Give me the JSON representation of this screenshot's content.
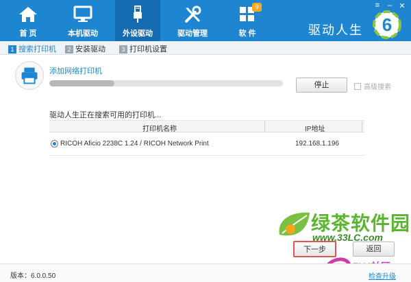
{
  "nav": {
    "items": [
      {
        "label": "首 页",
        "icon": "home-icon"
      },
      {
        "label": "本机驱动",
        "icon": "monitor-icon"
      },
      {
        "label": "外设驱动",
        "icon": "usb-icon"
      },
      {
        "label": "驱动管理",
        "icon": "tools-icon"
      },
      {
        "label": "软 件",
        "icon": "apps-grid-icon",
        "badge": "9"
      }
    ],
    "active_index": 2,
    "brand": "驱动人生",
    "brand_logo_text": "6"
  },
  "steps": [
    {
      "num": "1",
      "label": "搜索打印机",
      "active": true
    },
    {
      "num": "2",
      "label": "安装驱动",
      "active": false
    },
    {
      "num": "3",
      "label": "打印机设置",
      "active": false
    }
  ],
  "search": {
    "add_title": "添加网络打印机",
    "progress": 0.28,
    "stop_label": "停止",
    "advanced_label": "高级搜索",
    "advanced_checked": false,
    "status_text": "驱动人生正在搜索可用的打印机..."
  },
  "table": {
    "columns": [
      "打印机名称",
      "IP地址"
    ],
    "rows": [
      {
        "name": "RICOH Aficio 2238C 1.24 / RICOH Network Print",
        "ip": "192.168.1.196",
        "selected": true
      }
    ]
  },
  "actions": {
    "next_label": "下一步",
    "back_label": "返回"
  },
  "watermark": {
    "site_name": "绿茶软件园",
    "url": "www.33LC.com",
    "fly": "FLY社区"
  },
  "footer": {
    "version": "版本：6.0.0.50",
    "check_update": "检查升级"
  },
  "colors": {
    "accent": "#1e86d1",
    "nav_active": "#166cb0",
    "watermark_green": "#5cb531"
  }
}
